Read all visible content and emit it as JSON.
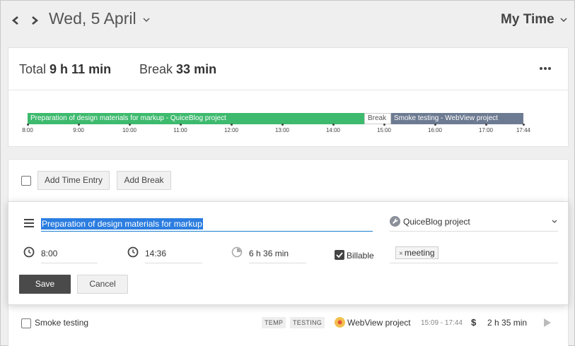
{
  "header": {
    "date_title": "Wed, 5 April",
    "view_selector": "My Time"
  },
  "summary": {
    "total_label": "Total",
    "total_value": "9 h 11 min",
    "break_label": "Break",
    "break_value": "33 min"
  },
  "timeline": {
    "segments": [
      {
        "label": "Preparation of design materials for markup - QuiceBlog project",
        "kind": "work",
        "color": "#3dba6e"
      },
      {
        "label": "Break",
        "kind": "break",
        "color": "#ffffff"
      },
      {
        "label": "Smoke testing - WebView project",
        "kind": "work",
        "color": "#6d7b92"
      }
    ],
    "ticks": [
      "8:00",
      "9:00",
      "10:00",
      "11:00",
      "12:00",
      "13:00",
      "14:00",
      "15:00",
      "16:00",
      "17:00",
      "17:44"
    ]
  },
  "toolbar": {
    "add_time_entry": "Add Time Entry",
    "add_break": "Add Break"
  },
  "editor": {
    "description": "Preparation of design materials for markup",
    "project": "QuiceBlog project",
    "start": "8:00",
    "end": "14:36",
    "duration": "6 h 36 min",
    "billable_label": "Billable",
    "billable": true,
    "tag": "meeting",
    "save": "Save",
    "cancel": "Cancel"
  },
  "entries": [
    {
      "description": "Smoke testing",
      "tags": [
        "TEMP",
        "TESTING"
      ],
      "project": "WebView project",
      "range": "15:09 - 17:44",
      "billable_symbol": "$",
      "duration": "2 h 35 min"
    }
  ],
  "colors": {
    "accent": "#2b7de0",
    "timeline_green": "#3dba6e",
    "timeline_gray": "#6d7b92",
    "save_button": "#4a4a4a"
  },
  "icons": {
    "prev": "chevron-left-icon",
    "next": "chevron-right-icon",
    "more": "more-horizontal-icon",
    "description": "list-icon",
    "start": "clock-icon",
    "end": "clock-icon",
    "duration": "timer-icon",
    "play": "play-icon"
  }
}
